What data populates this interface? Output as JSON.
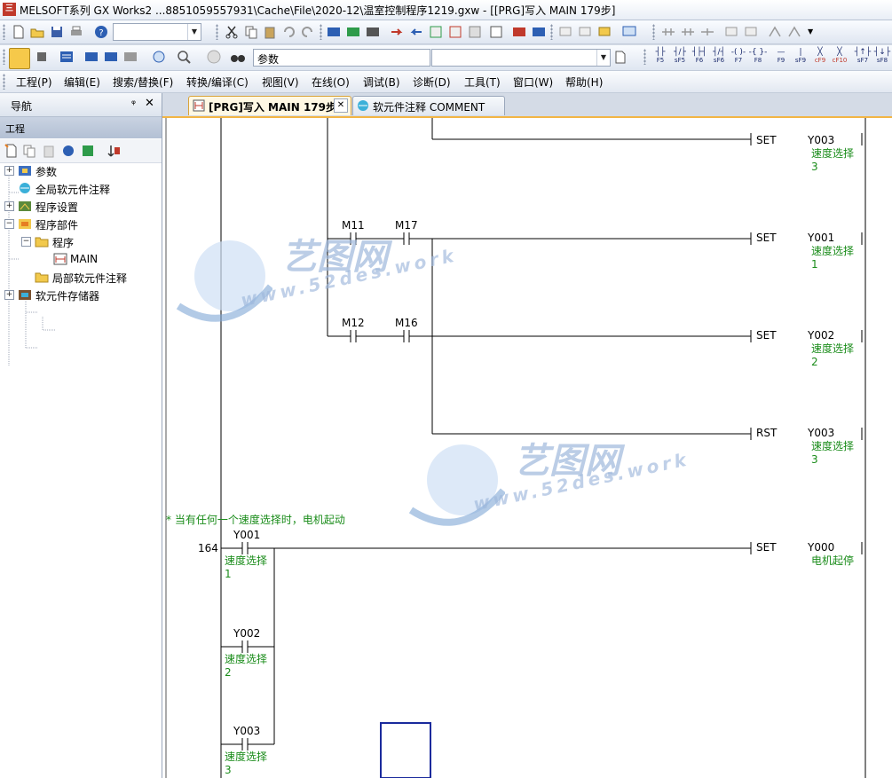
{
  "window": {
    "title": "MELSOFT系列 GX Works2 ...8851059557931\\Cache\\File\\2020-12\\温室控制程序1219.gxw - [[PRG]写入 MAIN 179步]"
  },
  "toolbar1": {
    "combo1_value": ""
  },
  "toolbar2": {
    "combo_search_value": "参数",
    "combo2_value": "",
    "fkeys": [
      "F5",
      "sF5",
      "F6",
      "sF6",
      "F7",
      "F8",
      "F9",
      "sF9",
      "cF9",
      "cF10",
      "sF7",
      "sF8"
    ]
  },
  "menu": [
    "工程(P)",
    "编辑(E)",
    "搜索/替换(F)",
    "转换/编译(C)",
    "视图(V)",
    "在线(O)",
    "调试(B)",
    "诊断(D)",
    "工具(T)",
    "窗口(W)",
    "帮助(H)"
  ],
  "nav": {
    "title": "导航",
    "pin": "ᵠ",
    "close": "✕",
    "section": "工程",
    "tree": [
      {
        "label": "参数",
        "expander": "+"
      },
      {
        "label": "全局软元件注释",
        "expander": ""
      },
      {
        "label": "程序设置",
        "expander": "+"
      },
      {
        "label": "程序部件",
        "expander": "−"
      },
      {
        "label": "程序",
        "expander": "−"
      },
      {
        "label": "MAIN",
        "expander": ""
      },
      {
        "label": "局部软元件注释",
        "expander": ""
      },
      {
        "label": "软元件存储器",
        "expander": "+"
      }
    ]
  },
  "tabs": [
    {
      "label": "[PRG]写入 MAIN 179步",
      "active": true,
      "close": "✕"
    },
    {
      "label": "软元件注释 COMMENT",
      "active": false
    }
  ],
  "ladder": {
    "statement": "* 当有任何一个速度选择时，电机起动",
    "step": "164",
    "contacts": {
      "m11": "M11",
      "m17": "M17",
      "m12": "M12",
      "m16": "M16",
      "y001": "Y001",
      "y002": "Y002",
      "y003": "Y003"
    },
    "contact_comments": {
      "y001": "速度选择\n1",
      "y002": "速度选择\n2",
      "y003": "速度选择\n3"
    },
    "coils": [
      {
        "instr": "SET",
        "device": "Y003",
        "comment": "速度选择\n3"
      },
      {
        "instr": "SET",
        "device": "Y001",
        "comment": "速度选择\n1"
      },
      {
        "instr": "SET",
        "device": "Y002",
        "comment": "速度选择\n2"
      },
      {
        "instr": "RST",
        "device": "Y003",
        "comment": "速度选择\n3"
      },
      {
        "instr": "SET",
        "device": "Y000",
        "comment": "电机起停"
      }
    ]
  },
  "watermark": {
    "cn": "艺图网",
    "url": "www.52des.work"
  },
  "colors": {
    "comment_green": "#1a8c1a",
    "tab_accent": "#f2b544",
    "cursor_blue": "#1a2a9c"
  }
}
